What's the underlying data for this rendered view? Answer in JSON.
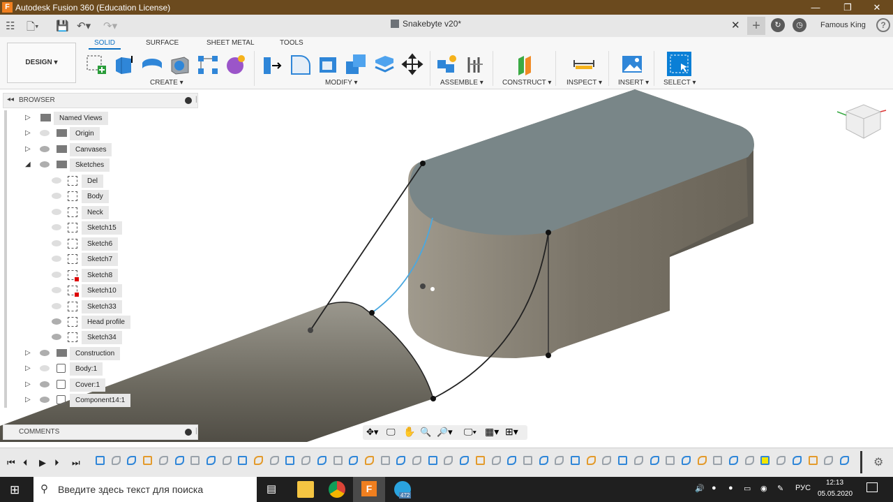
{
  "window": {
    "title": "Autodesk Fusion 360 (Education License)",
    "app_icon": "F"
  },
  "appbar": {
    "doc_title": "Snakebyte v20*",
    "user": "Famous King"
  },
  "toolbar": {
    "workspace": "DESIGN",
    "tabs": [
      "SOLID",
      "SURFACE",
      "SHEET METAL",
      "TOOLS"
    ],
    "groups": [
      "CREATE",
      "MODIFY",
      "ASSEMBLE",
      "CONSTRUCT",
      "INSPECT",
      "INSERT",
      "SELECT"
    ]
  },
  "browser": {
    "title": "BROWSER",
    "nodes": [
      {
        "label": "Named Views",
        "icon": "folder-icon",
        "expanded": false,
        "eye": false
      },
      {
        "label": "Origin",
        "icon": "folder-icon",
        "expanded": false,
        "eye": "off"
      },
      {
        "label": "Canvases",
        "icon": "folder-icon",
        "expanded": false,
        "eye": "on"
      },
      {
        "label": "Sketches",
        "icon": "folder-icon",
        "expanded": true,
        "eye": "on"
      },
      {
        "label": "Del",
        "icon": "sketch-icon",
        "eye": "off"
      },
      {
        "label": "Body",
        "icon": "sketch-icon",
        "eye": "off"
      },
      {
        "label": "Neck",
        "icon": "sketch-icon",
        "eye": "off"
      },
      {
        "label": "Sketch15",
        "icon": "sketch-icon",
        "eye": "off"
      },
      {
        "label": "Sketch6",
        "icon": "sketch-icon",
        "eye": "off"
      },
      {
        "label": "Sketch7",
        "icon": "sketch-icon",
        "eye": "off"
      },
      {
        "label": "Sketch8",
        "icon": "sketch-error-icon",
        "eye": "off"
      },
      {
        "label": "Sketch10",
        "icon": "sketch-error-icon",
        "eye": "off"
      },
      {
        "label": "Sketch33",
        "icon": "sketch-icon",
        "eye": "off"
      },
      {
        "label": "Head profile",
        "icon": "sketch-icon",
        "eye": "on"
      },
      {
        "label": "Sketch34",
        "icon": "sketch-icon",
        "eye": "on"
      },
      {
        "label": "Construction",
        "icon": "folder-icon",
        "expanded": false,
        "eye": "on"
      },
      {
        "label": "Body:1",
        "icon": "component-icon",
        "expanded": false,
        "eye": "off"
      },
      {
        "label": "Cover:1",
        "icon": "component-icon",
        "expanded": false,
        "eye": "on"
      },
      {
        "label": "Component14:1",
        "icon": "component-icon",
        "expanded": false,
        "eye": "on"
      }
    ]
  },
  "comments": {
    "title": "COMMENTS"
  },
  "taskbar": {
    "search_placeholder": "Введите здесь текст для поиска",
    "telegram_badge": "472",
    "lang": "РУС",
    "time": "12:13",
    "date": "05.05.2020"
  }
}
